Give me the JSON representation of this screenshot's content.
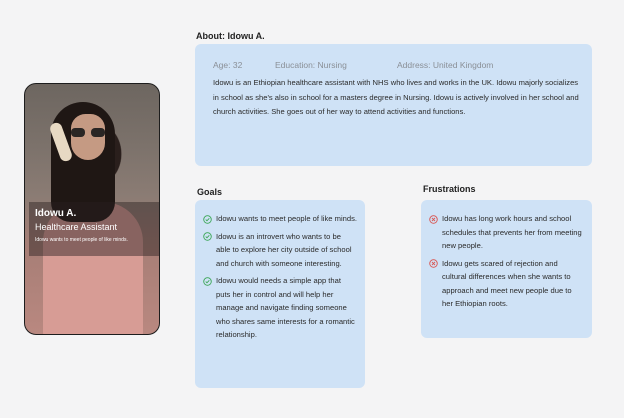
{
  "persona": {
    "name": "Idowu A.",
    "role": "Healthcare Assistant",
    "tagline": "Idowu wants to meet people of like minds."
  },
  "about": {
    "heading": "About: Idowu A.",
    "age": "Age: 32",
    "education": "Education: Nursing",
    "address": "Address: United Kingdom",
    "text": "Idowu is an Ethiopian healthcare assistant with NHS who lives and works in the UK. Idowu majorly socializes in school as she's also in school for a masters degree in Nursing. Idowu is actively involved in her school and church activities. She goes out of her way to attend activities and functions."
  },
  "goals": {
    "heading": "Goals",
    "items": [
      "Idowu wants to meet people of like minds.",
      "Idowu is an introvert who wants to be able to explore her city outside of school and church with someone interesting.",
      "Idowu would needs a simple app that puts her in control and will help her manage and navigate finding someone who shares same interests for a romantic relationship."
    ]
  },
  "frustrations": {
    "heading": "Frustrations",
    "items": [
      "Idowu has long work hours and school schedules that prevents her from meeting new people.",
      "Idowu gets scared of rejection and cultural differences when she wants to approach and meet new people due to her Ethiopian roots."
    ]
  },
  "colors": {
    "box_bg": "#cfe2f6",
    "check_green": "#3aa655",
    "cross_red": "#d9534f"
  }
}
